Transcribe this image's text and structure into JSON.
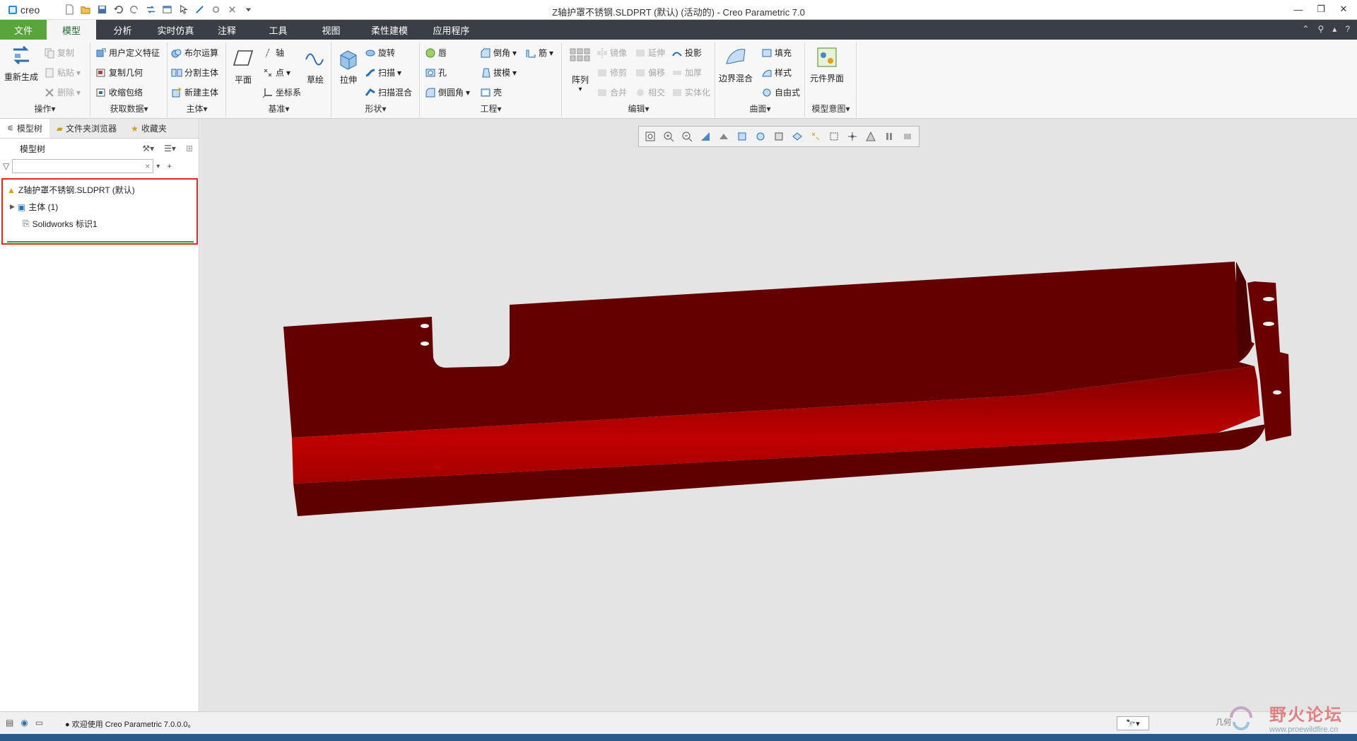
{
  "app": {
    "logo": "creo",
    "title": "Z轴护罩不锈钢.SLDPRT (默认) (活动的) - Creo Parametric 7.0"
  },
  "tabs": [
    {
      "label": "文件"
    },
    {
      "label": "模型"
    },
    {
      "label": "分析"
    },
    {
      "label": "实时仿真"
    },
    {
      "label": "注释"
    },
    {
      "label": "工具"
    },
    {
      "label": "视图"
    },
    {
      "label": "柔性建模"
    },
    {
      "label": "应用程序"
    }
  ],
  "ribbon": {
    "ops": {
      "regen": "重新生成",
      "copy": "复制",
      "paste": "粘贴",
      "delete": "删除",
      "group": "操作"
    },
    "data": {
      "udf": "用户定义特征",
      "copygeom": "复制几何",
      "shrinkwrap": "收缩包络",
      "group": "获取数据"
    },
    "body": {
      "boolean": "布尔运算",
      "split": "分割主体",
      "newbody": "新建主体",
      "group": "主体"
    },
    "datum": {
      "plane": "平面",
      "axis": "轴",
      "point": "点",
      "csys": "坐标系",
      "sketch": "草绘",
      "group": "基准"
    },
    "shape": {
      "extrude": "拉伸",
      "revolve": "旋转",
      "sweep": "扫描",
      "sweepblend": "扫描混合",
      "group": "形状"
    },
    "eng": {
      "hole": "孔",
      "round": "倒圆角",
      "chamfer": "倒角",
      "draft": "拔模",
      "shell": "壳",
      "rib": "筋",
      "layer": "唇",
      "group": "工程"
    },
    "edit": {
      "pattern": "阵列",
      "mirror": "镜像",
      "extend": "延伸",
      "project": "投影",
      "trim": "修剪",
      "offset": "偏移",
      "thicken": "加厚",
      "merge": "合并",
      "intersect": "相交",
      "solidify": "实体化",
      "group": "编辑"
    },
    "surface": {
      "boundary": "边界混合",
      "fill": "填充",
      "style": "样式",
      "freestyle": "自由式",
      "group": "曲面"
    },
    "intent": {
      "ci": "元件界面",
      "group": "模型意图"
    }
  },
  "sidepanel": {
    "tabs": [
      "模型树",
      "文件夹浏览器",
      "收藏夹"
    ],
    "header": "模型树",
    "filter_value": "",
    "tree": [
      {
        "label": "Z轴护罩不锈钢.SLDPRT (默认)"
      },
      {
        "label": "主体 (1)"
      },
      {
        "label": "Solidworks 标识1"
      }
    ]
  },
  "status": {
    "message": "欢迎使用 Creo Parametric 7.0.0.0。",
    "filter_label": "几何"
  },
  "watermark": {
    "text": "野火论坛",
    "url": "www.proewildfire.cn"
  },
  "colors": {
    "part": "#8a0000",
    "file_tab": "#5aa53b",
    "tree_highlight": "#e8281e"
  }
}
